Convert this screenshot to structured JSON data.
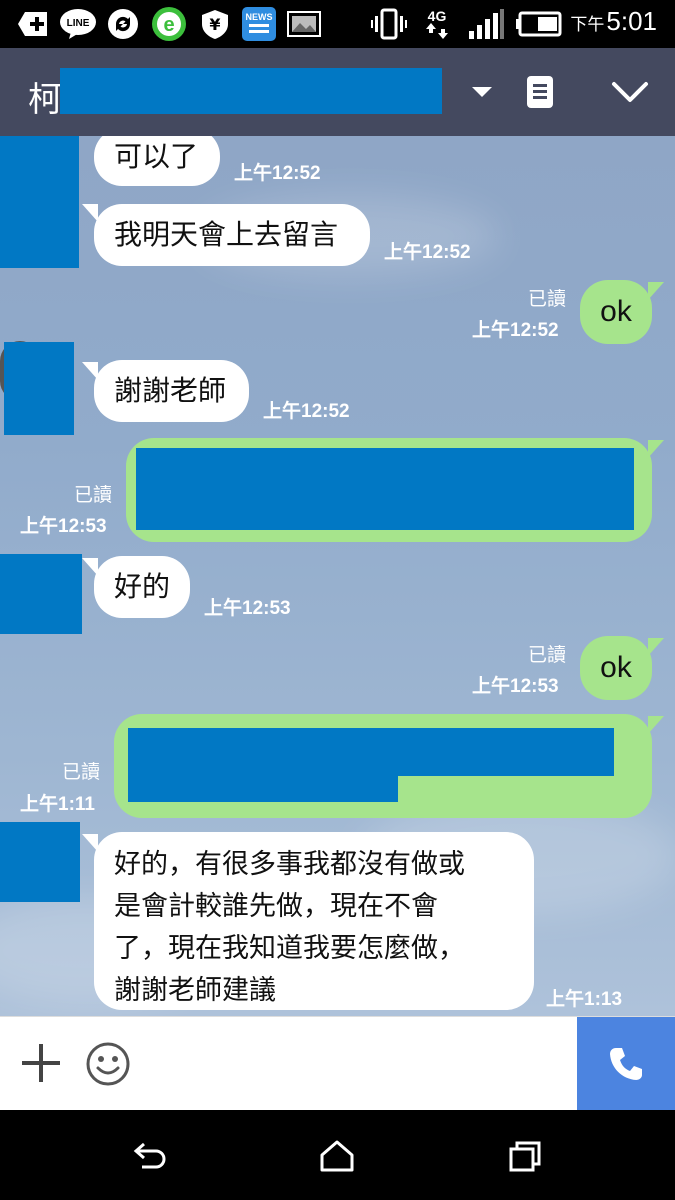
{
  "status_bar": {
    "icons": [
      "plus-box-icon",
      "line-app-icon",
      "sync-icon",
      "browser-e-icon",
      "shield-yen-icon",
      "news-app-icon",
      "photo-icon",
      "vibrate-icon",
      "network-4g-icon",
      "signal-bars-icon",
      "battery-icon"
    ],
    "network_label": "4G",
    "time_ampm": "下午",
    "time": "5:01"
  },
  "header": {
    "contact_name_visible": "柯"
  },
  "messages": [
    {
      "id": "m1",
      "dir": "in",
      "text": "可以了",
      "time": "上午12:52"
    },
    {
      "id": "m2",
      "dir": "in",
      "text": "我明天會上去留言",
      "time": "上午12:52"
    },
    {
      "id": "m3",
      "dir": "out",
      "text": "ok",
      "read": "已讀",
      "time": "上午12:52"
    },
    {
      "id": "m4",
      "dir": "in",
      "text": "謝謝老師",
      "time": "上午12:52"
    },
    {
      "id": "m5",
      "dir": "out",
      "text": "",
      "read": "已讀",
      "time": "上午12:53"
    },
    {
      "id": "m6",
      "dir": "in",
      "text": "好的",
      "time": "上午12:53"
    },
    {
      "id": "m7",
      "dir": "out",
      "text": "ok",
      "read": "已讀",
      "time": "上午12:53"
    },
    {
      "id": "m8",
      "dir": "out",
      "text": "",
      "read": "已讀",
      "time": "上午1:11"
    },
    {
      "id": "m9",
      "dir": "in",
      "lines": [
        "好的，有很多事我都沒有做或",
        "是會計較誰先做，現在不會",
        "了，現在我知道我要怎麼做，",
        "謝謝老師建議"
      ],
      "time": "上午1:13"
    }
  ],
  "colors": {
    "header_bg": "#44495f",
    "bubble_out": "#a6e48c",
    "bubble_in": "#ffffff",
    "redaction": "#0178c4",
    "call_button": "#4c84e0"
  }
}
